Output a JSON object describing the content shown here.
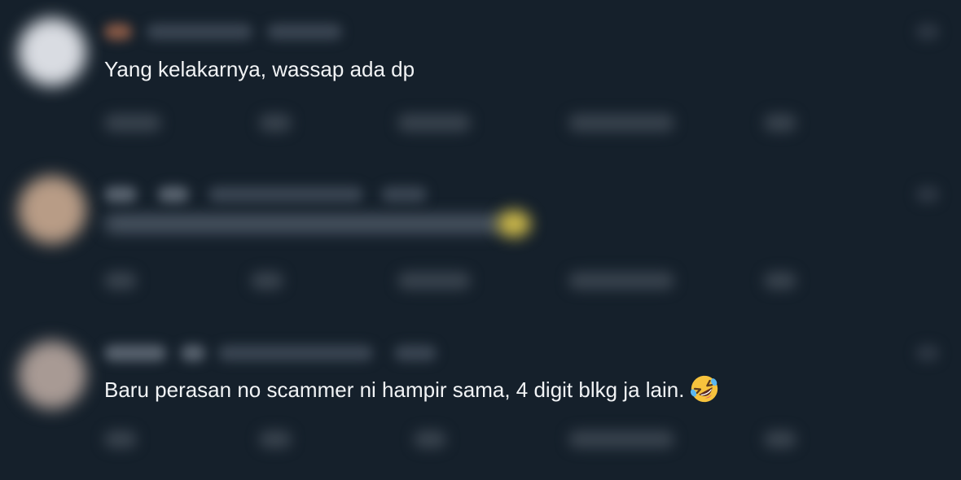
{
  "replies": [
    {
      "text": "Yang kelakarnya, wassap ada dp"
    },
    {
      "text": ""
    },
    {
      "text": "Baru perasan no scammer ni hampir sama, 4 digit blkg ja lain.",
      "emoji": "rolling-on-the-floor-laughing"
    }
  ],
  "colors": {
    "background": "#15202b",
    "text": "#f1f3f5",
    "blur": "#3a4552"
  }
}
